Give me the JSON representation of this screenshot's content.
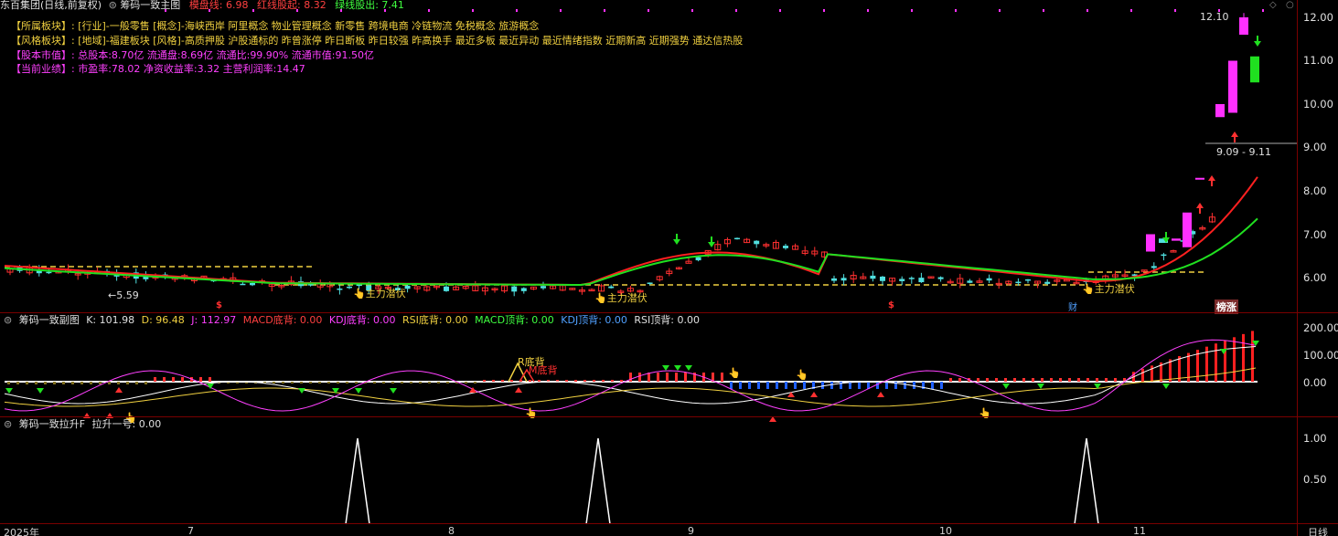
{
  "header": {
    "title": "东百集团(日线,前复权)",
    "indicator_name": "筹码一致主图",
    "label_ceiling": "模盘线: 6.98",
    "label_red": "红线股起: 8.32",
    "label_green": "绿线股出: 7.41"
  },
  "info": {
    "board_key": "【所属板块】:",
    "board_val": "[行业]-一般零售 [概念]-海峡西岸 阿里概念 物业管理概念 新零售 跨境电商 冷链物流 免税概念 旅游概念",
    "style_key": "【风格板块】:",
    "style_val": "[地域]-福建板块 [风格]-高质押股 沪股通标的 昨曾涨停 昨日断板 昨日较强 昨高换手 最近多板 最近异动 最近情绪指数 近期新高 近期强势 通达信热股",
    "equity_key": "【股本市值】:",
    "equity_val": "总股本:8.70亿 流通盘:8.69亿 流通比:99.90% 流通市值:91.50亿",
    "perf_key": "【当前业绩】:",
    "perf_val": "市盈率:78.02 净资收益率:3.32 主营利润率:14.47"
  },
  "main_axis": [
    "12.00",
    "11.00",
    "10.00",
    "9.00",
    "8.00",
    "7.00",
    "6.00"
  ],
  "annotations": {
    "high": "12.10",
    "low": "5.59",
    "range": "9.09 - 9.11",
    "signal1": "主力潜伏",
    "signal2": "主力潜伏",
    "signal3": "主力潜伏",
    "dragon": "榜涨",
    "cai": "财"
  },
  "sub1": {
    "name": "筹码一致副图",
    "k": "K: 101.98",
    "d": "D: 96.48",
    "j": "J: 112.97",
    "macd_bottom": "MACD底背: 0.00",
    "kdj_bottom": "KDJ底背: 0.00",
    "rsi_bottom": "RSI底背: 0.00",
    "macd_top": "MACD顶背: 0.00",
    "kdj_top": "KDJ顶背: 0.00",
    "rsi_top": "RSI顶背: 0.00",
    "axis": [
      "200.00",
      "100.00",
      "0.00"
    ],
    "r_label": "R底背",
    "m_label": "M底背"
  },
  "sub2": {
    "name": "筹码一致拉升F",
    "value": "拉升一号: 0.00",
    "axis": [
      "1.00",
      "0.50"
    ]
  },
  "xaxis": {
    "year": "2025年",
    "months": [
      "7",
      "8",
      "9",
      "10",
      "11"
    ],
    "period": "日线"
  },
  "colors": {
    "up": "#ff3030",
    "down": "#50e0e0",
    "red_line": "#ff2020",
    "green_line": "#20e020",
    "magenta": "#ff30ff"
  }
}
